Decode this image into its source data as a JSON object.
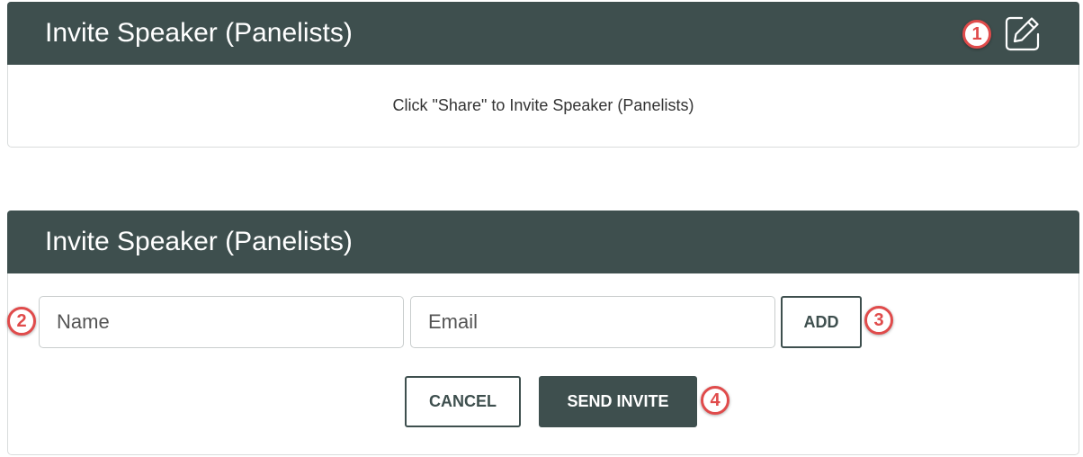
{
  "share_panel": {
    "title": "Invite Speaker (Panelists)",
    "info_text": "Click \"Share\" to Invite Speaker (Panelists)",
    "edit_icon": "edit-icon"
  },
  "invite_panel": {
    "title": "Invite Speaker (Panelists)",
    "name_placeholder": "Name",
    "email_placeholder": "Email",
    "add_label": "ADD",
    "cancel_label": "CANCEL",
    "send_label": "SEND INVITE"
  },
  "badges": [
    "1",
    "2",
    "3",
    "4"
  ],
  "colors": {
    "header_bg": "#3e4f4e",
    "badge": "#e04b4b"
  }
}
